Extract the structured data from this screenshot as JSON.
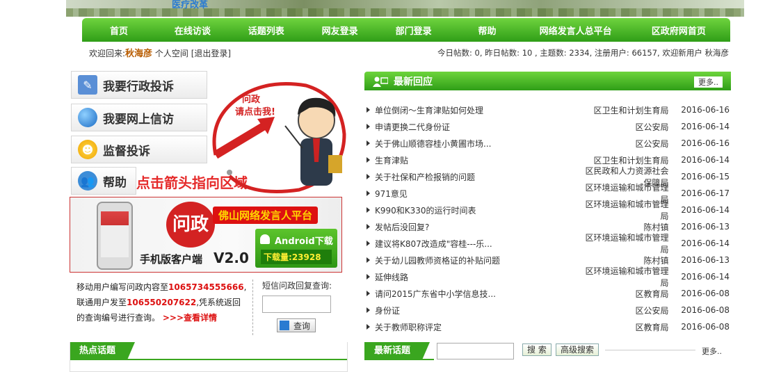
{
  "banner": {
    "title": "医疗改革"
  },
  "nav": [
    "首页",
    "在线访谈",
    "话题列表",
    "网友登录",
    "部门登录",
    "帮助",
    "网络发言人总平台",
    "区政府网首页"
  ],
  "user": {
    "welcome": "欢迎回来:",
    "name": "秋海彦",
    "space": "个人空间",
    "logout": "[退出登录]"
  },
  "stats": "今日帖数: 0, 昨日帖数: 10 , 主题数: 2334, 注册用户: 66157, 欢迎新用户 秋海彦",
  "side_buttons": [
    {
      "label": "我要行政投诉",
      "icon": "pencil-icon"
    },
    {
      "label": "我要网上信访",
      "icon": "globe-icon"
    },
    {
      "label": "监督投诉",
      "icon": "person-icon"
    },
    {
      "label": "帮助",
      "icon": "users-icon"
    }
  ],
  "hint": "点击箭头指向区域",
  "cartoon": {
    "line1": "问政",
    "line2": "请点击我!"
  },
  "app": {
    "bubble": "问政",
    "title": "佛山网络发言人平台",
    "sub": "手机版客户端",
    "version": "V2.0",
    "android": "Android下载",
    "downloads_label": "下载量:",
    "downloads": "23928"
  },
  "mobile_info": {
    "p1": "移动用户编写问政内容至",
    "num1": "1065734555666",
    "p2": ",联通用户发至",
    "num2": "106550207622",
    "p3": ",凭系统返回的查询编号进行查询。",
    "link": ">>>查看详情"
  },
  "sms": {
    "label": "短信问政回复查询:",
    "button": "查询"
  },
  "replies": {
    "title": "最新回应",
    "more": "更多..",
    "items": [
      {
        "t": "单位倒闭～生育津贴如何处理",
        "d": "区卫生和计划生育局",
        "dt": "2016-06-16"
      },
      {
        "t": "申请更换二代身份证",
        "d": "区公安局",
        "dt": "2016-06-14"
      },
      {
        "t": "关于佛山顺德容桂小黄圃市场...",
        "d": "区公安局",
        "dt": "2016-06-16"
      },
      {
        "t": "生育津贴",
        "d": "区卫生和计划生育局",
        "dt": "2016-06-14"
      },
      {
        "t": "关于社保和产检报销的问题",
        "d": "区民政和人力资源社会保障局",
        "dt": "2016-06-15"
      },
      {
        "t": "971意见",
        "d": "区环境运输和城市管理局",
        "dt": "2016-06-17"
      },
      {
        "t": "K990和K330的运行时间表",
        "d": "区环境运输和城市管理局",
        "dt": "2016-06-14"
      },
      {
        "t": "发帖后没回复?",
        "d": "陈村镇",
        "dt": "2016-06-13"
      },
      {
        "t": "建议将K807改造成\"容桂---乐...",
        "d": "区环境运输和城市管理局",
        "dt": "2016-06-14"
      },
      {
        "t": "关于幼儿园教师资格证的补贴问题",
        "d": "陈村镇",
        "dt": "2016-06-13"
      },
      {
        "t": "延伸线路",
        "d": "区环境运输和城市管理局",
        "dt": "2016-06-14"
      },
      {
        "t": "请问2015广东省中小学信息技...",
        "d": "区教育局",
        "dt": "2016-06-08"
      },
      {
        "t": "身份证",
        "d": "区公安局",
        "dt": "2016-06-08"
      },
      {
        "t": "关于教师职称评定",
        "d": "区教育局",
        "dt": "2016-06-08"
      }
    ]
  },
  "hot": {
    "title": "热点话题"
  },
  "newest": {
    "title": "最新话题",
    "search": "搜 索",
    "adv": "高级搜索",
    "more": "更多.."
  }
}
